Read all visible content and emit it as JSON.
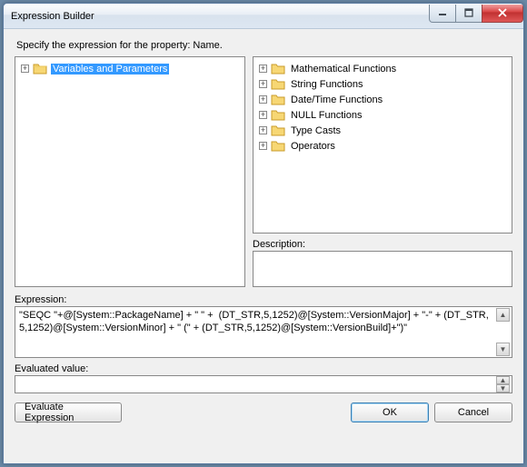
{
  "window": {
    "title": "Expression Builder"
  },
  "instruction": "Specify the expression for the property: Name.",
  "left_tree": {
    "items": [
      {
        "label": "Variables and Parameters",
        "selected": true
      }
    ]
  },
  "right_tree": {
    "items": [
      {
        "label": "Mathematical Functions"
      },
      {
        "label": "String Functions"
      },
      {
        "label": "Date/Time Functions"
      },
      {
        "label": "NULL Functions"
      },
      {
        "label": "Type Casts"
      },
      {
        "label": "Operators"
      }
    ]
  },
  "description": {
    "label": "Description:"
  },
  "expression": {
    "label": "Expression:",
    "value": "\"SEQC \"+@[System::PackageName] + \" \" +  (DT_STR,5,1252)@[System::VersionMajor] + \"-\" + (DT_STR,5,1252)@[System::VersionMinor] + \" (\" + (DT_STR,5,1252)@[System::VersionBuild]+\")\""
  },
  "evaluated": {
    "label": "Evaluated value:"
  },
  "buttons": {
    "evaluate": "Evaluate Expression",
    "ok": "OK",
    "cancel": "Cancel"
  }
}
